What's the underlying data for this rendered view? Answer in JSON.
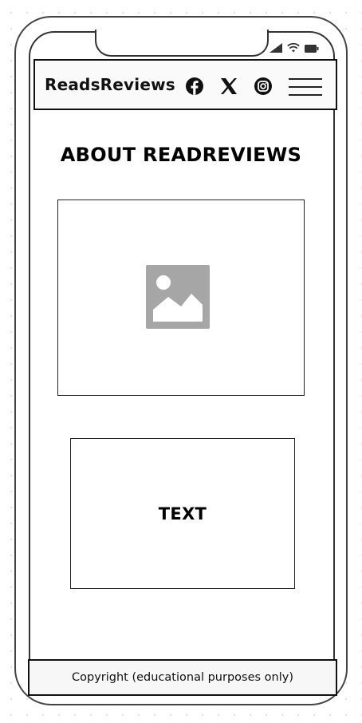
{
  "navbar": {
    "brand": "ReadsReviews",
    "icons": [
      "facebook-icon",
      "x-icon",
      "instagram-icon",
      "hamburger-menu-icon"
    ]
  },
  "status_bar": {
    "icons": [
      "cellular-signal-icon",
      "wifi-icon",
      "battery-icon"
    ]
  },
  "main": {
    "title": "ABOUT READREVIEWS",
    "image_placeholder_icon": "image-placeholder-icon",
    "text_box_label": "TEXT"
  },
  "footer": {
    "text": "Copyright (educational purposes only)"
  },
  "colors": {
    "placeholder_gray": "#a6a6a6",
    "border_dark": "#222222",
    "footer_bg": "#f7f7f7"
  }
}
